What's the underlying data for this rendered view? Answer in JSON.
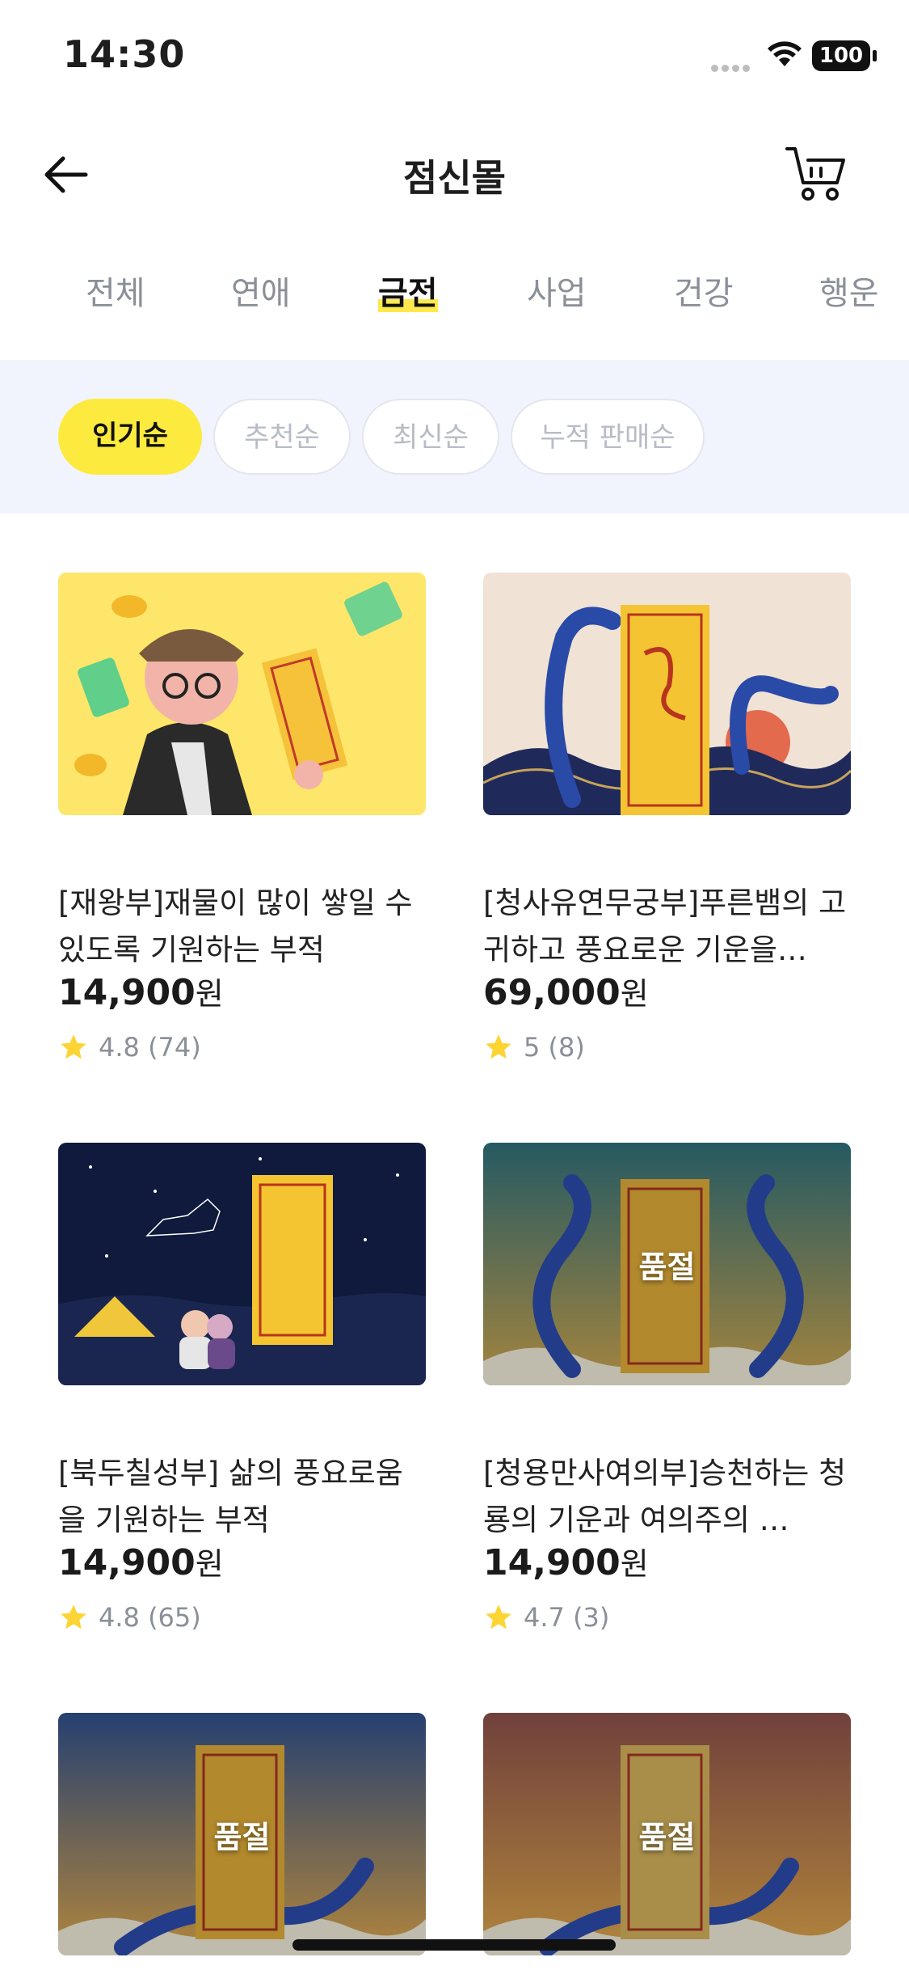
{
  "status_bar": {
    "time": "14:30",
    "battery": "100"
  },
  "header": {
    "title": "점신몰",
    "back_icon": "arrow-left-icon",
    "cart_icon": "cart-icon"
  },
  "tabs": [
    {
      "label": "전체",
      "active": false
    },
    {
      "label": "연애",
      "active": false
    },
    {
      "label": "금전",
      "active": true
    },
    {
      "label": "사업",
      "active": false
    },
    {
      "label": "건강",
      "active": false
    },
    {
      "label": "행운",
      "active": false
    }
  ],
  "sort_chips": [
    {
      "label": "인기순",
      "active": true
    },
    {
      "label": "추천순",
      "active": false
    },
    {
      "label": "최신순",
      "active": false
    },
    {
      "label": "누적 판매순",
      "active": false
    }
  ],
  "products": [
    {
      "title": "[재왕부]재물이 많이 쌓일 수 있도록 기원하는 부적",
      "price": "14,900",
      "currency": "원",
      "rating": "4.8",
      "reviews": "(74)",
      "soldout": ""
    },
    {
      "title": "[청사유연무궁부]푸른뱀의 고귀하고 풍요로운 기운을…",
      "price": "69,000",
      "currency": "원",
      "rating": "5",
      "reviews": "(8)",
      "soldout": ""
    },
    {
      "title": "[북두칠성부] 삶의 풍요로움을 기원하는 부적",
      "price": "14,900",
      "currency": "원",
      "rating": "4.8",
      "reviews": "(65)",
      "soldout": ""
    },
    {
      "title": "[청용만사여의부]승천하는 청룡의 기운과 여의주의 …",
      "price": "14,900",
      "currency": "원",
      "rating": "4.7",
      "reviews": "(3)",
      "soldout": "품절"
    },
    {
      "title": "",
      "price": "",
      "currency": "",
      "rating": "",
      "reviews": "",
      "soldout": "품절"
    },
    {
      "title": "",
      "price": "",
      "currency": "",
      "rating": "",
      "reviews": "",
      "soldout": "품절"
    }
  ],
  "colors": {
    "accent_yellow": "#fdea3f",
    "star": "#fcd535",
    "sortbar_bg": "#f1f4fd"
  }
}
